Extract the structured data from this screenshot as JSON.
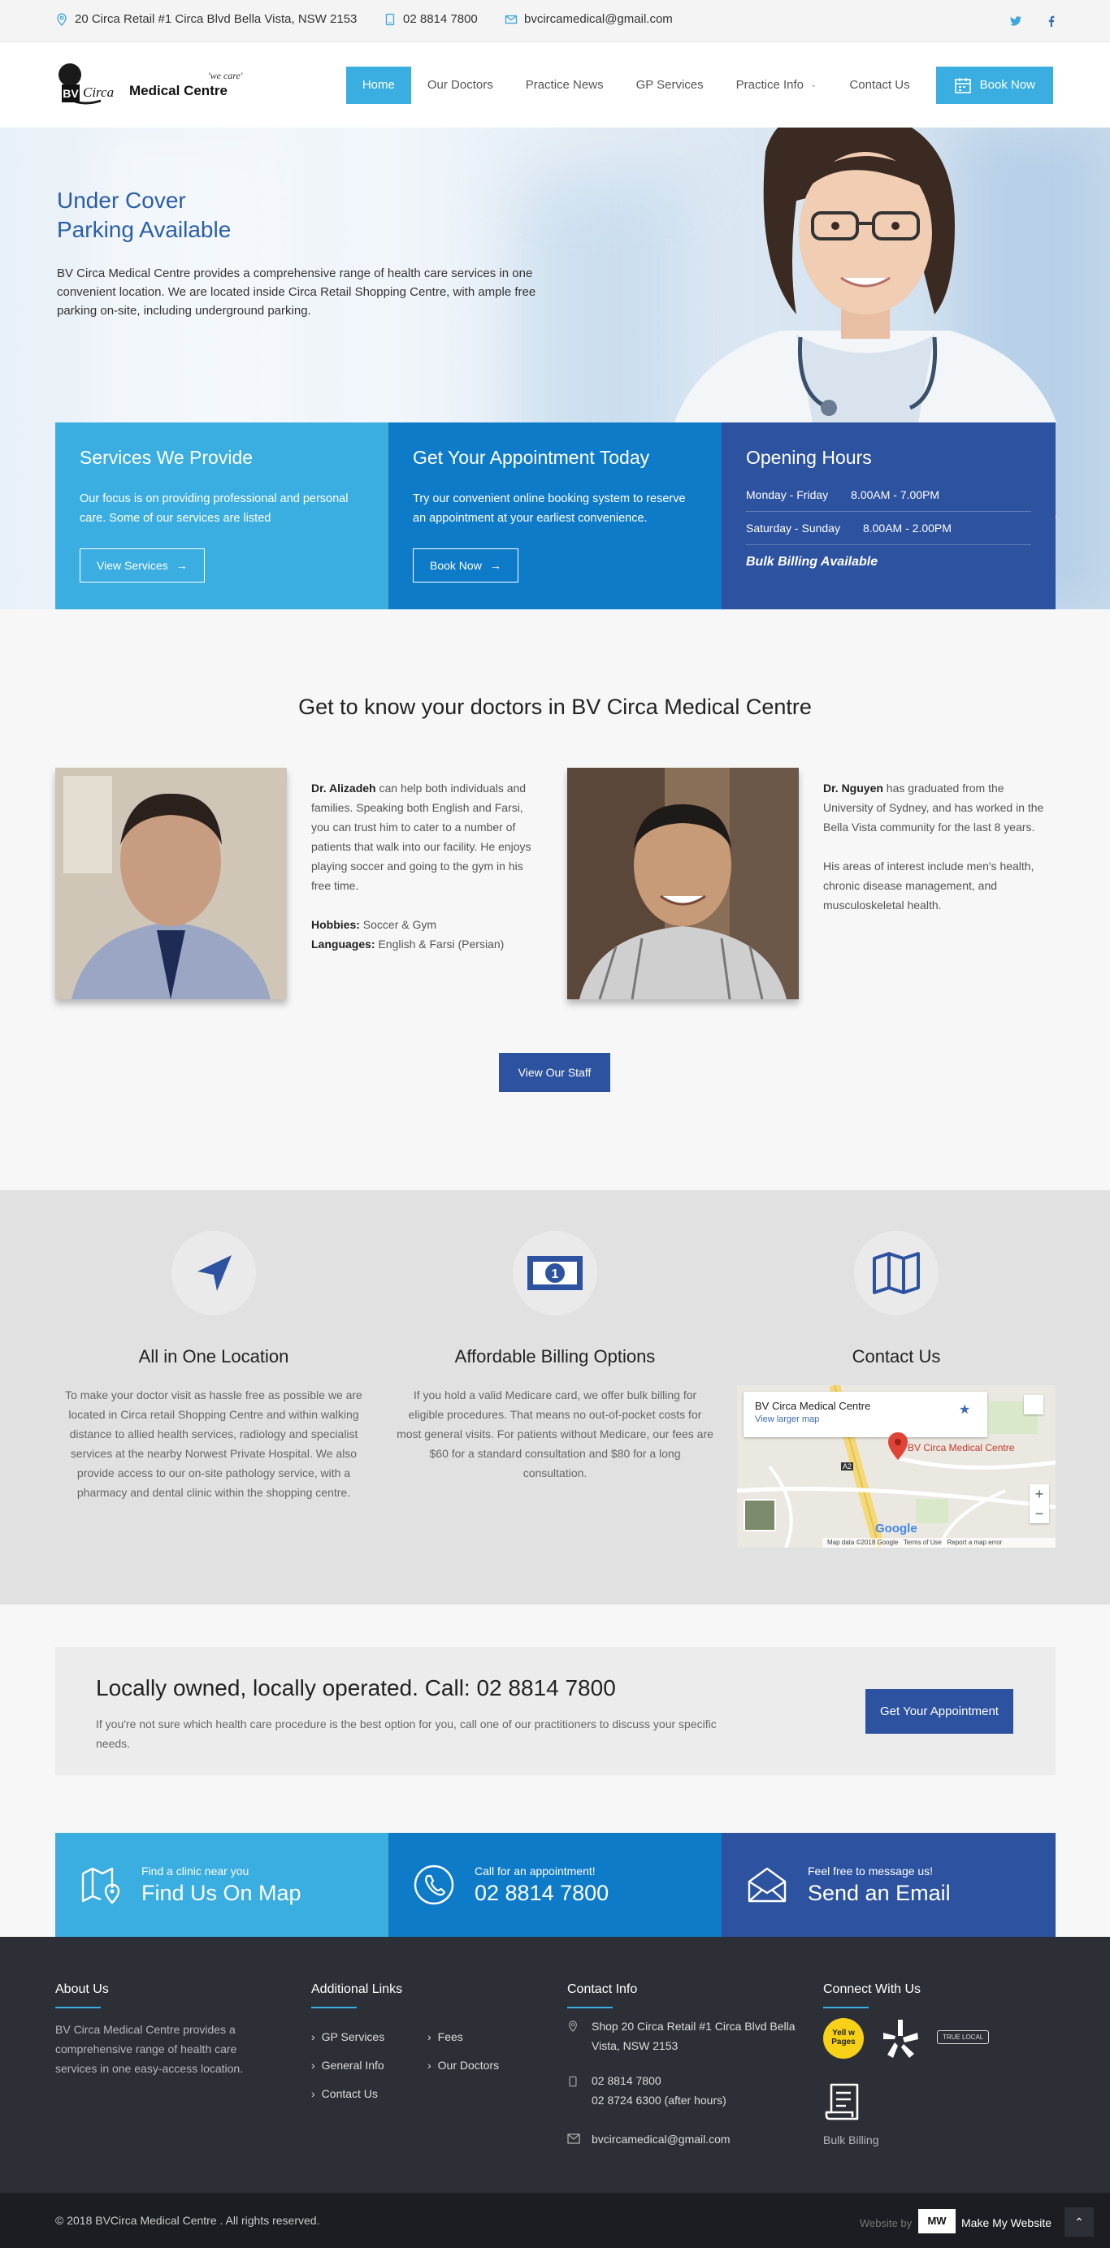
{
  "topbar": {
    "address": "20 Circa Retail #1 Circa Blvd Bella Vista, NSW 2153",
    "phone": "02 8814 7800",
    "email": "bvcircamedical@gmail.com"
  },
  "logo": {
    "bv": "BV",
    "circa": "Circa",
    "name": "Medical Centre",
    "tagline": "'we care'"
  },
  "nav": {
    "items": [
      "Home",
      "Our Doctors",
      "Practice News",
      "GP Services",
      "Practice Info",
      "Contact Us"
    ],
    "book": "Book Now"
  },
  "hero": {
    "title_1": "Under Cover",
    "title_2": "Parking Available",
    "text": "BV Circa Medical Centre provides a comprehensive range of health care services in one convenient location. We are located inside Circa Retail Shopping Centre, with ample free parking on-site, including underground parking."
  },
  "boxes": {
    "services": {
      "title": "Services We Provide",
      "text": "Our focus is on providing professional and personal care. Some of our services are listed",
      "button": "View Services"
    },
    "appointment": {
      "title": "Get Your Appointment Today",
      "text": "Try our convenient online booking system to reserve an appointment at your earliest convenience.",
      "button": "Book Now"
    },
    "hours": {
      "title": "Opening Hours",
      "rows": [
        {
          "day": "Monday - Friday",
          "time": "8.00AM - 7.00PM"
        },
        {
          "day": "Saturday - Sunday",
          "time": "8.00AM - 2.00PM"
        }
      ],
      "note": "Bulk Billing Available"
    }
  },
  "doctors": {
    "title": "Get to know your doctors in BV Circa Medical Centre",
    "alizadeh": {
      "name": "Dr. Alizadeh",
      "text": "can help both individuals and families. Speaking both English and Farsi, you can trust him to cater to a number of patients that walk into our facility. He enjoys playing soccer and going to the gym in his free time.",
      "hobbies_label": "Hobbies:",
      "hobbies": "Soccer & Gym",
      "languages_label": "Languages:",
      "languages": "English & Farsi (Persian)"
    },
    "nguyen": {
      "name": "Dr. Nguyen",
      "text": "has graduated from the University of Sydney, and has worked in the Bella Vista community for the last 8 years.",
      "text2": "His areas of interest include men's health, chronic disease management, and musculoskeletal health."
    },
    "button": "View Our Staff"
  },
  "features": {
    "location": {
      "title": "All in One Location",
      "text": "To make your doctor visit as hassle free as possible we are located in Circa retail Shopping Centre and within walking distance to allied health services, radiology and specialist services at the nearby Norwest Private Hospital. We also provide access to our on-site pathology service, with a pharmacy and dental clinic within the shopping centre."
    },
    "billing": {
      "title": "Affordable Billing Options",
      "text": "If you hold a valid Medicare card, we offer bulk billing for eligible procedures. That means no out-of-pocket costs for most general visits. For patients without Medicare, our fees are $60 for a standard consultation and $80 for a long consultation."
    },
    "contact": {
      "title": "Contact Us"
    },
    "map": {
      "place": "BV Circa Medical Centre",
      "link": "View larger map",
      "pin_label": "BV Circa Medical Centre",
      "google": "Google",
      "footer": "Map data ©2018 Google   Terms of Use   Report a map error",
      "road": "A2"
    }
  },
  "cta": {
    "title": "Locally owned, locally operated. Call: 02 8814 7800",
    "text": "If you're not sure which health care procedure is the best option for you, call one of our practitioners to discuss your specific needs.",
    "button": "Get Your Appointment"
  },
  "strip": {
    "map": {
      "small": "Find a clinic near you",
      "large": "Find Us On Map"
    },
    "call": {
      "small": "Call for an appointment!",
      "large": "02 8814 7800"
    },
    "email": {
      "small": "Feel free to message us!",
      "large": "Send an Email"
    }
  },
  "footer": {
    "about": {
      "title": "About Us",
      "text": "BV Circa Medical Centre provides a comprehensive range of health care services in one easy-access location."
    },
    "links": {
      "title": "Additional Links",
      "items": [
        "GP Services",
        "Fees",
        "General Info",
        "Our Doctors",
        "Contact Us"
      ]
    },
    "contact": {
      "title": "Contact Info",
      "address": "Shop 20 Circa Retail #1 Circa Blvd Bella Vista, NSW 2153",
      "phone1": "02 8814 7800",
      "phone2": "02 8724 6300 (after hours)",
      "email": "bvcircamedical@gmail.com"
    },
    "connect": {
      "title": "Connect With Us",
      "yellow": "Yell w Pages",
      "truelocal": "TRUE LOCAL",
      "bulk": "Bulk Billing"
    }
  },
  "bottom": {
    "copyright": "© 2018 BVCirca Medical Centre . All rights reserved.",
    "website_by": "Website by",
    "maker": "Make My Website"
  },
  "colors": {
    "accent": "#3aaee0",
    "mid_blue": "#0e7bc9",
    "dark_blue": "#2c52a0",
    "footer": "#2c2f36"
  }
}
